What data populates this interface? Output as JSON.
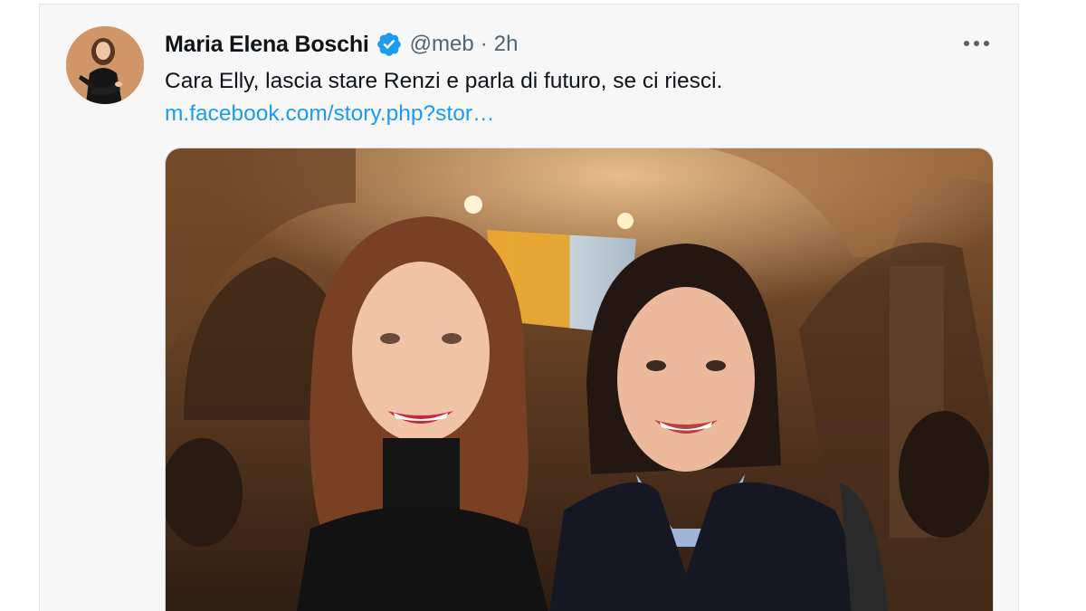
{
  "tweet": {
    "display_name": "Maria Elena Boschi",
    "handle": "@meb",
    "separator": "·",
    "time": "2h",
    "text": "Cara Elly, lascia stare Renzi e parla di futuro, se ci riesci.",
    "link_text": "m.facebook.com/story.php?stor…",
    "verified": true
  },
  "icons": {
    "verified": "verified-badge-icon",
    "more": "more-options-icon"
  },
  "colors": {
    "link": "#1d9bf0",
    "verified": "#1d9bf0",
    "name": "#0f1419",
    "secondary": "#536471"
  }
}
